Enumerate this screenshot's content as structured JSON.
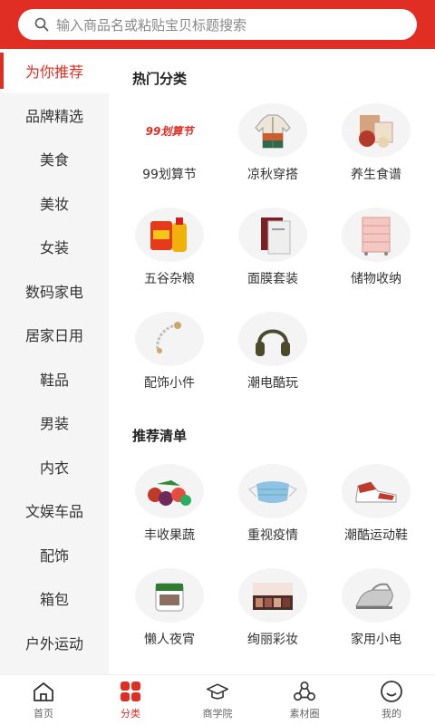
{
  "search": {
    "placeholder": "输入商品名或粘贴宝贝标题搜索"
  },
  "sidebar": {
    "items": [
      {
        "label": "为你推荐"
      },
      {
        "label": "品牌精选"
      },
      {
        "label": "美食"
      },
      {
        "label": "美妆"
      },
      {
        "label": "女装"
      },
      {
        "label": "数码家电"
      },
      {
        "label": "居家日用"
      },
      {
        "label": "鞋品"
      },
      {
        "label": "男装"
      },
      {
        "label": "内衣"
      },
      {
        "label": "文娱车品"
      },
      {
        "label": "配饰"
      },
      {
        "label": "箱包"
      },
      {
        "label": "户外运动"
      }
    ]
  },
  "hot": {
    "title": "热门分类",
    "items": [
      {
        "label": "99划算节",
        "icon": "99-logo-icon",
        "logo_text": "99划算节"
      },
      {
        "label": "凉秋穿搭",
        "icon": "jacket-icon"
      },
      {
        "label": "养生食谱",
        "icon": "tea-box-icon"
      },
      {
        "label": "五谷杂粮",
        "icon": "rice-oil-icon"
      },
      {
        "label": "面膜套装",
        "icon": "facemask-icon"
      },
      {
        "label": "储物收纳",
        "icon": "drawer-icon"
      },
      {
        "label": "配饰小件",
        "icon": "bracelet-icon"
      },
      {
        "label": "潮电酷玩",
        "icon": "headphones-icon"
      }
    ]
  },
  "recommend": {
    "title": "推荐清单",
    "items": [
      {
        "label": "丰收果蔬",
        "icon": "fruits-icon"
      },
      {
        "label": "重视疫情",
        "icon": "mask-icon"
      },
      {
        "label": "潮酷运动鞋",
        "icon": "sneaker-icon"
      },
      {
        "label": "懒人夜宵",
        "icon": "snack-icon"
      },
      {
        "label": "绚丽彩妆",
        "icon": "palette-icon"
      },
      {
        "label": "家用小电",
        "icon": "iron-icon"
      }
    ]
  },
  "tabbar": {
    "items": [
      {
        "label": "首页",
        "icon": "home-icon"
      },
      {
        "label": "分类",
        "icon": "category-icon"
      },
      {
        "label": "商学院",
        "icon": "graduation-cap-icon"
      },
      {
        "label": "素材圈",
        "icon": "nodes-icon"
      },
      {
        "label": "我的",
        "icon": "profile-icon"
      }
    ]
  },
  "colors": {
    "brand": "#e02e24",
    "sidebar_bg": "#f5f5f5",
    "thumb_bg": "#f4f4f4"
  }
}
